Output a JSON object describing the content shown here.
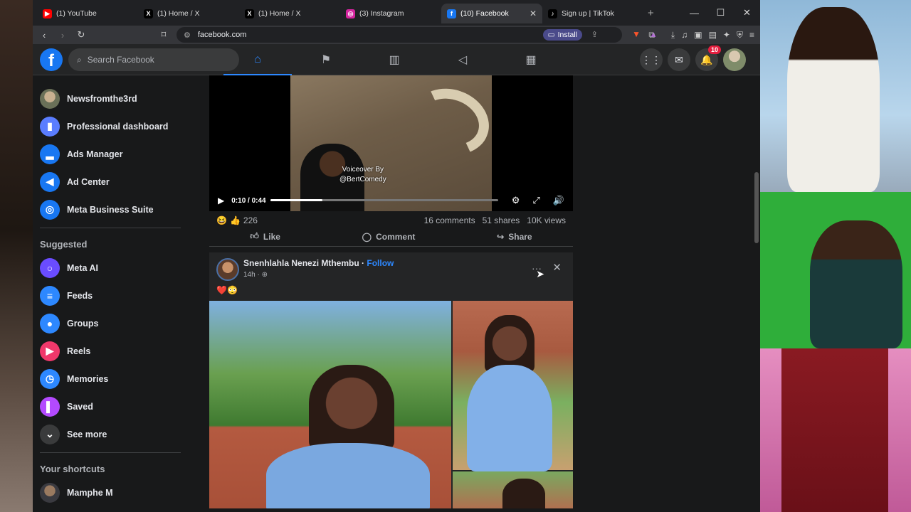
{
  "browser": {
    "tabs": [
      {
        "label": "(1) YouTube",
        "icon": "youtube-icon",
        "color": "#ff0000",
        "glyph": "▶"
      },
      {
        "label": "(1) Home / X",
        "icon": "x-icon",
        "color": "#000000",
        "glyph": "X"
      },
      {
        "label": "(1) Home / X",
        "icon": "x-icon",
        "color": "#000000",
        "glyph": "X"
      },
      {
        "label": "(3) Instagram",
        "icon": "instagram-icon",
        "color": "#d6249f",
        "glyph": "◎"
      },
      {
        "label": "(10) Facebook",
        "icon": "facebook-icon",
        "color": "#1877f2",
        "glyph": "f",
        "active": true
      },
      {
        "label": "Sign up | TikTok",
        "icon": "tiktok-icon",
        "color": "#000000",
        "glyph": "♪"
      }
    ],
    "new_tab": "+",
    "url": "facebook.com",
    "install_label": "Install"
  },
  "facebook": {
    "logo": "f",
    "search_placeholder": "Search Facebook",
    "notifications_count": "10"
  },
  "sidebar": {
    "profile_name": "Newsfromthe3rd",
    "items_top": [
      {
        "label": "Professional dashboard",
        "icon": "dashboard-icon",
        "color": "#5a7dff",
        "glyph": "▮"
      },
      {
        "label": "Ads Manager",
        "icon": "ads-manager-icon",
        "color": "#1877f2",
        "glyph": "▂"
      },
      {
        "label": "Ad Center",
        "icon": "ad-center-icon",
        "color": "#1877f2",
        "glyph": "◀"
      },
      {
        "label": "Meta Business Suite",
        "icon": "meta-business-suite-icon",
        "color": "#1877f2",
        "glyph": "◎"
      }
    ],
    "suggested_title": "Suggested",
    "items_suggested": [
      {
        "label": "Meta AI",
        "icon": "meta-ai-icon",
        "color": "#6a4cff",
        "glyph": "○"
      },
      {
        "label": "Feeds",
        "icon": "feeds-icon",
        "color": "#2d88ff",
        "glyph": "≡"
      },
      {
        "label": "Groups",
        "icon": "groups-icon",
        "color": "#2d88ff",
        "glyph": "●"
      },
      {
        "label": "Reels",
        "icon": "reels-icon",
        "color": "#f0386b",
        "glyph": "▶"
      },
      {
        "label": "Memories",
        "icon": "memories-icon",
        "color": "#2d88ff",
        "glyph": "◷"
      },
      {
        "label": "Saved",
        "icon": "saved-icon",
        "color": "#b44aff",
        "glyph": "▌"
      },
      {
        "label": "See more",
        "icon": "chevron-down-icon",
        "color": "#3a3b3c",
        "glyph": "⌄"
      }
    ],
    "shortcuts_title": "Your shortcuts",
    "shortcut_name": "Mamphe M"
  },
  "video_post": {
    "overlay_line1": "Voiceover By",
    "overlay_line2": "@BertComedy",
    "time": "0:10 / 0:44",
    "progress": 0.227,
    "reaction_count": "226",
    "comments": "16 comments",
    "shares": "51 shares",
    "views": "10K views",
    "like_label": "Like",
    "comment_label": "Comment",
    "share_label": "Share"
  },
  "photo_post": {
    "author": "Snenhlahla Nenezi Mthembu",
    "separator": " · ",
    "follow_label": "Follow",
    "time": "14h",
    "text": "❤️😳"
  }
}
